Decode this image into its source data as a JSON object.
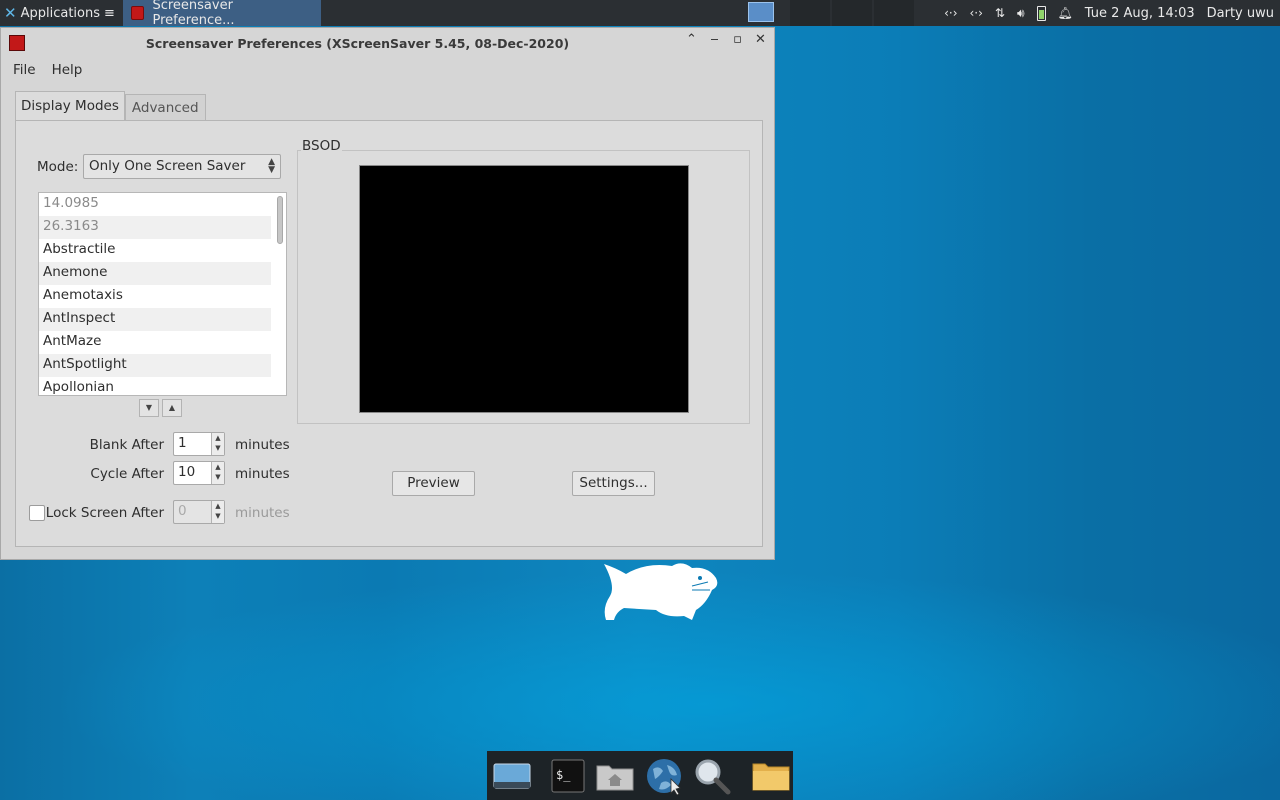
{
  "panel": {
    "apps_label": "Applications",
    "task_label": "Screensaver Preference...",
    "datetime": "Tue  2 Aug, 14:03",
    "user": "Darty uwu"
  },
  "window": {
    "title": "Screensaver Preferences  (XScreenSaver 5.45, 08-Dec-2020)",
    "menu": [
      "File",
      "Help"
    ],
    "tabs": [
      "Display Modes",
      "Advanced"
    ],
    "mode_label": "Mode:",
    "mode_value": "Only One Screen Saver",
    "savers": [
      "14.0985",
      "26.3163",
      "Abstractile",
      "Anemone",
      "Anemotaxis",
      "AntInspect",
      "AntMaze",
      "AntSpotlight",
      "Apollonian"
    ],
    "preview_title": "BSOD",
    "blank_after_label": "Blank After",
    "blank_after_value": "1",
    "cycle_after_label": "Cycle After",
    "cycle_after_value": "10",
    "lock_label": "Lock Screen After",
    "lock_value": "0",
    "minutes": "minutes",
    "preview_button": "Preview",
    "settings_button": "Settings..."
  },
  "colors": {
    "desktop": "#0b7ab3",
    "panel": "#2b2f33",
    "active_task": "#3d5f84",
    "window_bg": "#d6d6d6"
  }
}
